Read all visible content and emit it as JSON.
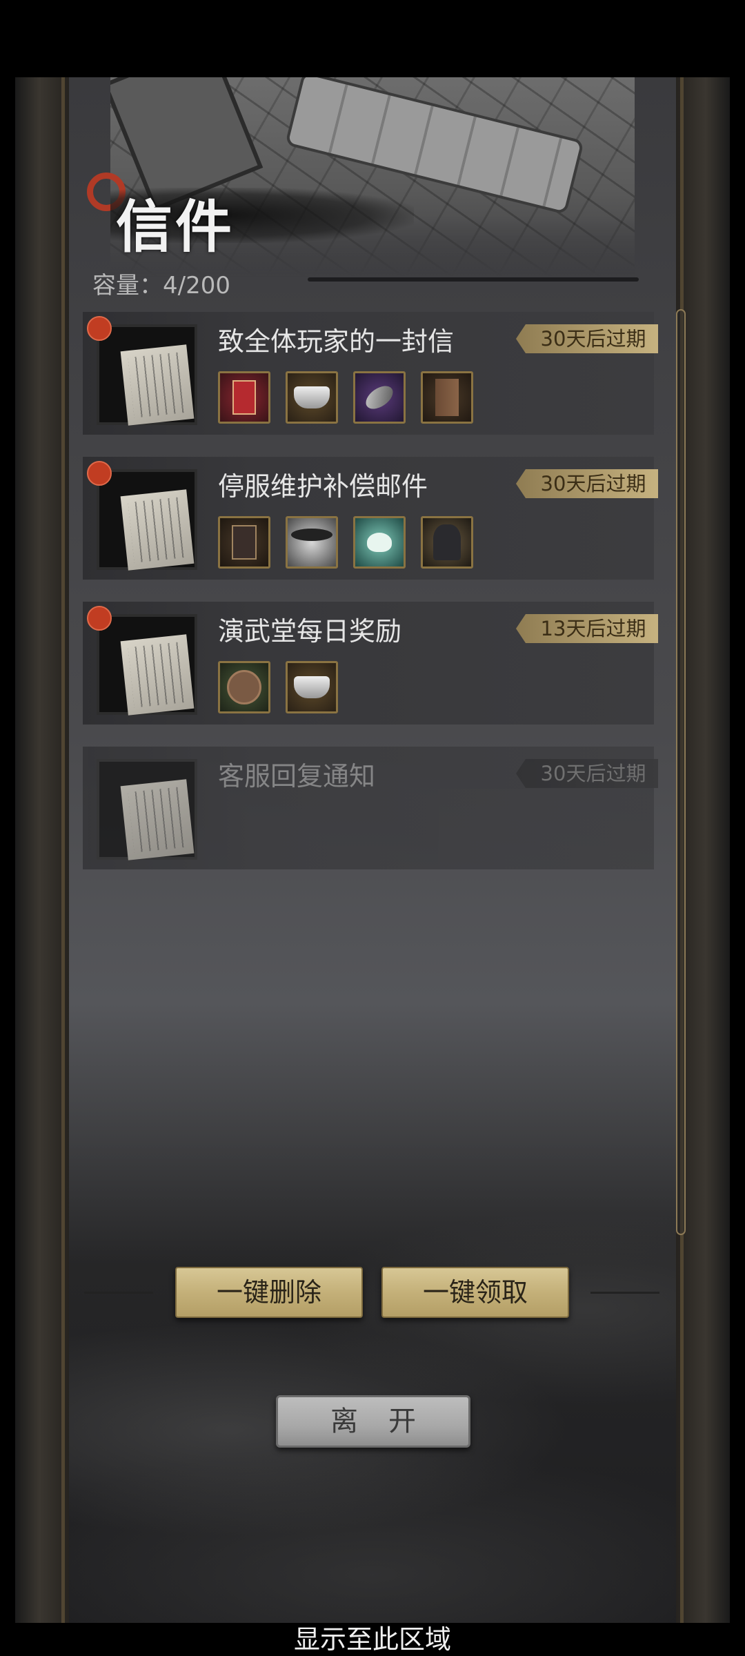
{
  "header": {
    "title": "信件",
    "capacity_label": "容量：4/200"
  },
  "mails": [
    {
      "title": "致全体玩家的一封信",
      "expire": "30天后过期",
      "unread": true,
      "rewards": [
        "red-token-icon",
        "silver-ingot-icon",
        "gem-stone-icon",
        "wood-plank-icon"
      ]
    },
    {
      "title": "停服维护补偿邮件",
      "expire": "30天后过期",
      "unread": true,
      "rewards": [
        "seal-token-icon",
        "character-portrait-icon",
        "lotus-icon",
        "armored-warrior-icon"
      ]
    },
    {
      "title": "演武堂每日奖励",
      "expire": "13天后过期",
      "unread": true,
      "rewards": [
        "copper-coin-icon",
        "silver-ingot-icon"
      ]
    },
    {
      "title": "客服回复通知",
      "expire": "30天后过期",
      "unread": false,
      "rewards": []
    }
  ],
  "actions": {
    "delete_all": "一键删除",
    "claim_all": "一键领取",
    "leave": "离开"
  },
  "footer": {
    "text": "显示至此区域"
  },
  "colors": {
    "accent_gold": "#c4b079",
    "unread_red": "#c13d22",
    "panel": "#3c3c3f"
  }
}
